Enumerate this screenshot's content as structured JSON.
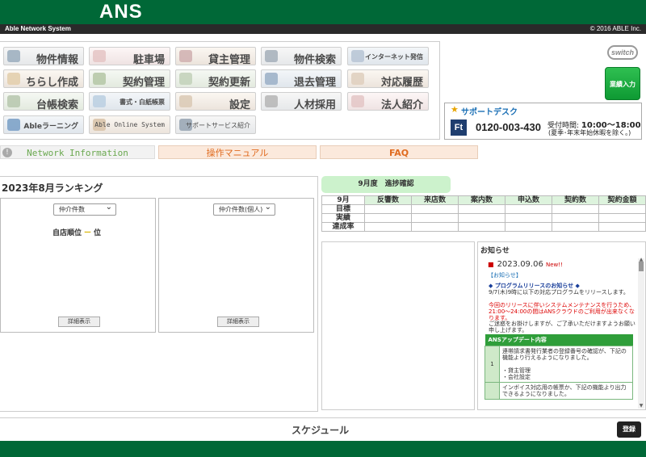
{
  "app": {
    "title": "ANS",
    "subtitle": "Able Network System",
    "copyright": "© 2016 ABLE Inc."
  },
  "menu": [
    {
      "label": "物件情報",
      "icon": "house-icon"
    },
    {
      "label": "駐車場",
      "icon": "parking-icon"
    },
    {
      "label": "貸主管理",
      "icon": "owners-icon"
    },
    {
      "label": "物件検索",
      "icon": "house-search-icon"
    },
    {
      "label": "インターネット発信",
      "icon": "internet-icon"
    },
    {
      "label": "ちらし作成",
      "icon": "flyer-icon"
    },
    {
      "label": "契約管理",
      "icon": "contract-icon"
    },
    {
      "label": "契約更新",
      "icon": "contract-renew-icon"
    },
    {
      "label": "退去管理",
      "icon": "moveout-icon"
    },
    {
      "label": "対応履歴",
      "icon": "history-icon"
    },
    {
      "label": "台帳検索",
      "icon": "ledger-search-icon"
    },
    {
      "label": "書式・白紙帳票",
      "icon": "form-icon"
    },
    {
      "label": "設定",
      "icon": "gear-icon"
    },
    {
      "label": "人材採用",
      "icon": "recruit-icon"
    },
    {
      "label": "法人紹介",
      "icon": "corporate-icon"
    },
    {
      "label": "Ableラーニング",
      "icon": "learning-icon"
    },
    {
      "label": "Able Online System",
      "icon": "online-system-icon"
    },
    {
      "label": "サポートサービス紹介",
      "icon": "support-service-icon"
    }
  ],
  "switch_label": "switch",
  "business_input": "業績入力",
  "support": {
    "title": "サポートデスク",
    "logo": "Ft",
    "phone": "0120-003-430",
    "hours_label": "受付時間:",
    "hours": "10:00〜18:00",
    "note": "(夏季･年末年始休暇を除く。)"
  },
  "tabs": {
    "network": "Network Information",
    "manual": "操作マニュアル",
    "faq": "FAQ"
  },
  "ranking": {
    "title": "2023年8月ランキング",
    "select1": "仲介件数",
    "select2": "仲介件数(個人)",
    "own_rank_label": "自店順位",
    "own_rank_value": "ー",
    "own_rank_unit": "位",
    "detail1": "詳細表示",
    "detail2": "詳細表示"
  },
  "progress": {
    "title": "9月度　進捗確認",
    "columns": [
      "9月",
      "反響数",
      "来店数",
      "案内数",
      "申込数",
      "契約数",
      "契約金額"
    ],
    "rows": [
      "目標",
      "実績",
      "達成率"
    ]
  },
  "news": {
    "title": "お知らせ",
    "date": "2023.09.06",
    "new_badge": "New!!",
    "tag": "【お知らせ】",
    "heading": "◆ プログラムリリースのお知らせ ◆",
    "line1": "9/7(木)9時に以下の対応プログラムをリリースします。",
    "warning": "今回のリリースに伴いシステムメンテナンスを行うため、21:00〜24:00の間はANSクラウドのご利用が出来なくなります。",
    "apology": "ご迷惑をお掛けしますが、ご了承いただけますようお願い申し上げます。",
    "update_header": "ANSアップデート内容",
    "item1_num": "1",
    "item1": "連帯請求書発行業者の登録番号の確認が、下記の機能より行えるようになりました。",
    "item1_sub1": "・貸主管理",
    "item1_sub2": "・会社設定",
    "item2": "インボイス対応用の帳票か、下記の機能より出力できるようになりました。"
  },
  "schedule": {
    "title": "スケジュール",
    "register": "登録"
  }
}
